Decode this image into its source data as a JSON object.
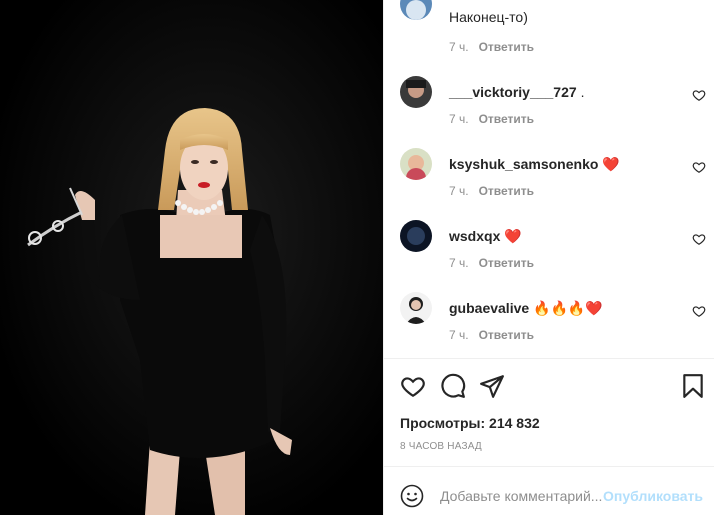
{
  "post": {
    "media_alt": "Woman in black dress with pearl necklace",
    "colors": {
      "media_bg": "#000000",
      "accent_blue": "#b2dffc",
      "text": "#262626",
      "muted": "#8e8e8e",
      "heart_red": "#ed4956"
    }
  },
  "comments": [
    {
      "username": "",
      "text": "Наконец-то)",
      "time": "7 ч.",
      "reply": "Ответить",
      "avatar_icon": "avatar-icon",
      "truncated_top": true
    },
    {
      "username": "___vicktoriy___727",
      "text": ".",
      "time": "7 ч.",
      "reply": "Ответить",
      "avatar_icon": "avatar-icon"
    },
    {
      "username": "ksyshuk_samsonenko",
      "text": "❤️",
      "time": "7 ч.",
      "reply": "Ответить",
      "avatar_icon": "avatar-icon"
    },
    {
      "username": "wsdxqx",
      "text": "❤️",
      "time": "7 ч.",
      "reply": "Ответить",
      "avatar_icon": "avatar-icon"
    },
    {
      "username": "gubaevalive",
      "text": "🔥🔥🔥❤️",
      "time": "7 ч.",
      "reply": "Ответить",
      "avatar_icon": "avatar-icon"
    }
  ],
  "actions": {
    "like_icon": "heart-icon",
    "comment_icon": "comment-icon",
    "share_icon": "share-icon",
    "save_icon": "bookmark-icon"
  },
  "stats": {
    "views_label": "Просмотры: 214 832",
    "time_ago": "8 часов назад"
  },
  "composer": {
    "placeholder": "Добавьте комментарий...",
    "publish_label": "Опубликовать",
    "emoji_icon": "smiley-icon"
  }
}
